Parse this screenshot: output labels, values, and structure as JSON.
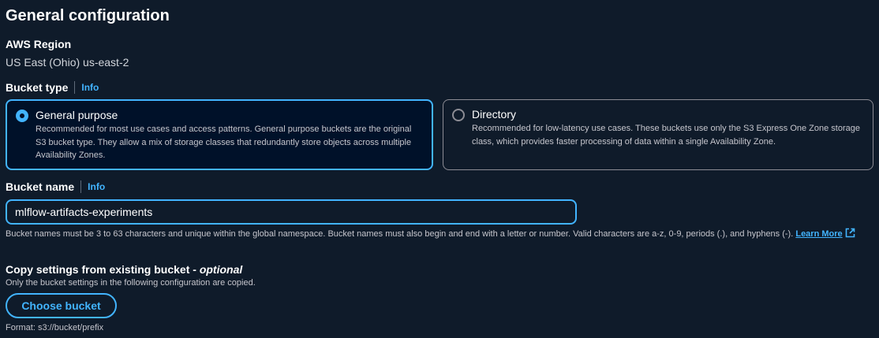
{
  "section_title": "General configuration",
  "region": {
    "label": "AWS Region",
    "value": "US East (Ohio) us-east-2"
  },
  "bucket_type": {
    "label": "Bucket type",
    "info": "Info",
    "options": [
      {
        "title": "General purpose",
        "description": "Recommended for most use cases and access patterns. General purpose buckets are the original S3 bucket type. They allow a mix of storage classes that redundantly store objects across multiple Availability Zones.",
        "selected": true
      },
      {
        "title": "Directory",
        "description": "Recommended for low-latency use cases. These buckets use only the S3 Express One Zone storage class, which provides faster processing of data within a single Availability Zone.",
        "selected": false
      }
    ]
  },
  "bucket_name": {
    "label": "Bucket name",
    "info": "Info",
    "value": "mlflow-artifacts-experiments",
    "help": "Bucket names must be 3 to 63 characters and unique within the global namespace. Bucket names must also begin and end with a letter or number. Valid characters are a-z, 0-9, periods (.), and hyphens (-).",
    "learn_more": "Learn More"
  },
  "copy_settings": {
    "label": "Copy settings from existing bucket - ",
    "label_optional": "optional",
    "description": "Only the bucket settings in the following configuration are copied.",
    "button": "Choose bucket",
    "format": "Format: s3://bucket/prefix"
  },
  "colors": {
    "accent": "#42b4ff",
    "background": "#0f1b2a",
    "selected_tile": "#001129"
  }
}
